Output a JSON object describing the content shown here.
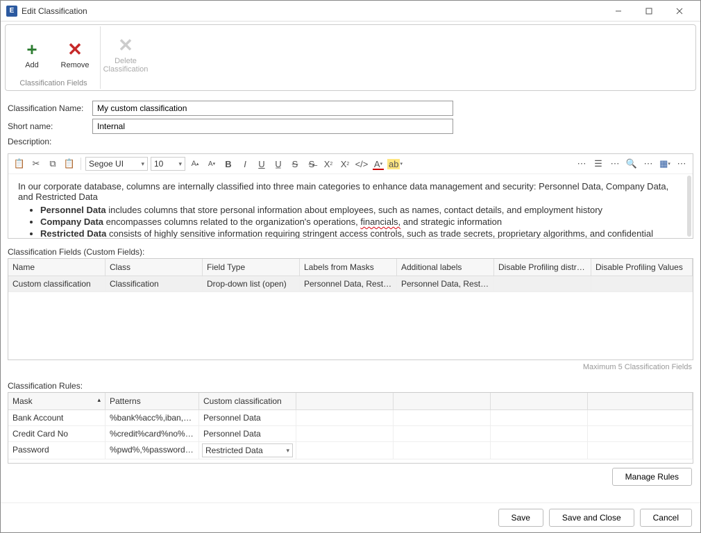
{
  "window": {
    "title": "Edit Classification"
  },
  "ribbon": {
    "add_label": "Add",
    "remove_label": "Remove",
    "delete_label": "Delete Classification",
    "group_label": "Classification Fields"
  },
  "form": {
    "name_label": "Classification Name:",
    "name_value": "My custom classification",
    "shortname_label": "Short name:",
    "shortname_value": "Internal",
    "description_label": "Description:"
  },
  "editor": {
    "font": "Segoe UI",
    "size": "10",
    "intro": "In our corporate database, columns are internally classified into three main categories to enhance data management and security: Personnel Data, Company Data, and Restricted Data",
    "bullet1_term": "Personnel Data",
    "bullet1_rest": " includes columns that store personal information about employees, such as names, contact details, and employment history",
    "bullet2_term": "Company Data",
    "bullet2_rest_a": " encompasses columns related to the organization's operations, ",
    "bullet2_rest_squig": "financials,",
    "bullet2_rest_b": " and strategic information",
    "bullet3_term": "Restricted Data",
    "bullet3_rest": " consists of highly sensitive information requiring stringent access controls, such as trade secrets, proprietary algorithms, and confidential"
  },
  "fields_section": {
    "label": "Classification Fields (Custom Fields):",
    "footer": "Maximum 5 Classification Fields",
    "headers": {
      "name": "Name",
      "class": "Class",
      "fieldtype": "Field Type",
      "labels_masks": "Labels from Masks",
      "addl_labels": "Additional labels",
      "disable_dist": "Disable Profiling distributi…",
      "disable_vals": "Disable Profiling Values"
    },
    "row": {
      "name": "Custom classification",
      "class": "Classification",
      "fieldtype": "Drop-down list (open)",
      "labels_masks": "Personnel Data, Restrict…",
      "addl_labels": "Personnel Data, Restrict…",
      "disable_dist": "",
      "disable_vals": ""
    }
  },
  "rules_section": {
    "label": "Classification Rules:",
    "headers": {
      "mask": "Mask",
      "patterns": "Patterns",
      "custom": "Custom classification"
    },
    "rows": [
      {
        "mask": "Bank Account",
        "patterns": "%bank%acc%,iban,%ib…",
        "custom": "Personnel Data"
      },
      {
        "mask": "Credit Card No",
        "patterns": "%credit%card%no%,%…",
        "custom": "Personnel Data"
      },
      {
        "mask": "Password",
        "patterns": "%pwd%,%password%,…",
        "custom": "Restricted Data"
      }
    ],
    "manage_label": "Manage Rules"
  },
  "buttons": {
    "save": "Save",
    "save_close": "Save and Close",
    "cancel": "Cancel"
  }
}
